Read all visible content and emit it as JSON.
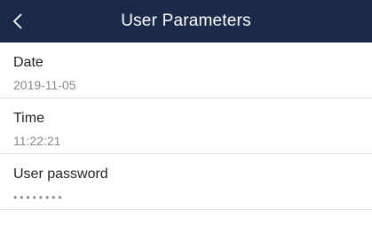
{
  "header": {
    "title": "User Parameters",
    "back_icon": "chevron-left-icon"
  },
  "rows": [
    {
      "label": "Date",
      "value": "2019-11-05"
    },
    {
      "label": "Time",
      "value": "11:22:21"
    },
    {
      "label": "User password",
      "value": "••••••••"
    }
  ],
  "colors": {
    "header_bg": "#1b2a4a",
    "header_text": "#ffffff",
    "label": "#222222",
    "value": "#8a8a8a",
    "divider": "#e3e3e3"
  }
}
